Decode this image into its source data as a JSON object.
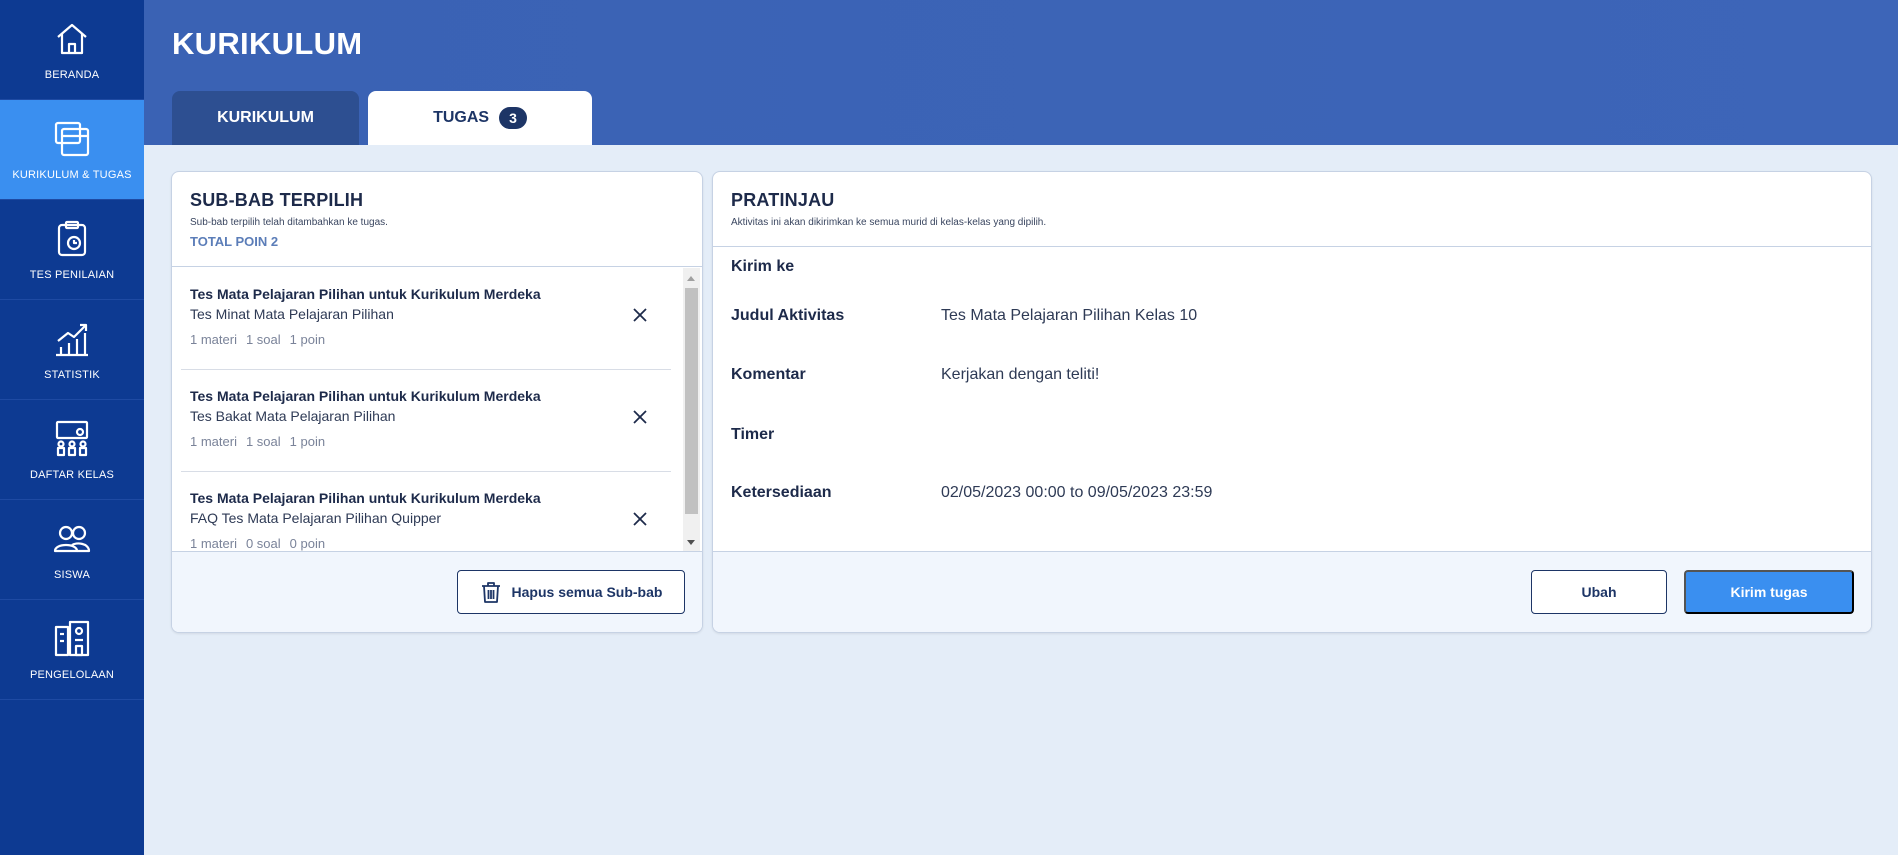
{
  "sidebar": {
    "items": [
      {
        "label": "BERANDA",
        "icon": "home-icon"
      },
      {
        "label": "KURIKULUM & TUGAS",
        "icon": "curriculum-icon",
        "active": true
      },
      {
        "label": "TES PENILAIAN",
        "icon": "assessment-icon"
      },
      {
        "label": "STATISTIK",
        "icon": "chart-icon"
      },
      {
        "label": "DAFTAR KELAS",
        "icon": "classroom-icon"
      },
      {
        "label": "SISWA",
        "icon": "students-icon"
      },
      {
        "label": "PENGELOLAAN",
        "icon": "building-icon"
      }
    ]
  },
  "header": {
    "title": "KURIKULUM",
    "tabs": [
      {
        "label": "KURIKULUM",
        "active": false
      },
      {
        "label": "TUGAS",
        "badge": "3",
        "active": true
      }
    ]
  },
  "left_panel": {
    "title": "SUB-BAB TERPILIH",
    "subtitle": "Sub-bab terpilih telah ditambahkan ke tugas.",
    "total": "TOTAL POIN 2",
    "items": [
      {
        "title": "Tes Mata Pelajaran Pilihan untuk Kurikulum Merdeka",
        "subtitle": "Tes Minat Mata Pelajaran Pilihan",
        "materi": "1 materi",
        "soal": "1 soal",
        "poin": "1 poin"
      },
      {
        "title": "Tes Mata Pelajaran Pilihan untuk Kurikulum Merdeka",
        "subtitle": "Tes Bakat Mata Pelajaran Pilihan",
        "materi": "1 materi",
        "soal": "1 soal",
        "poin": "1 poin"
      },
      {
        "title": "Tes Mata Pelajaran Pilihan untuk Kurikulum Merdeka",
        "subtitle": "FAQ Tes Mata Pelajaran Pilihan Quipper",
        "materi": "1 materi",
        "soal": "0 soal",
        "poin": "0 poin"
      }
    ],
    "delete_all_label": "Hapus semua Sub-bab"
  },
  "right_panel": {
    "title": "PRATINJAU",
    "subtitle": "Aktivitas ini akan dikirimkan ke semua murid di kelas-kelas yang dipilih.",
    "fields": {
      "kirim_ke": {
        "label": "Kirim ke",
        "value": ""
      },
      "judul": {
        "label": "Judul Aktivitas",
        "value": "Tes Mata Pelajaran Pilihan Kelas 10"
      },
      "komentar": {
        "label": "Komentar",
        "value": "Kerjakan dengan teliti!"
      },
      "timer": {
        "label": "Timer",
        "value": ""
      },
      "ketersediaan": {
        "label": "Ketersediaan",
        "value": "02/05/2023 00:00 to 09/05/2023 23:59"
      }
    },
    "edit_label": "Ubah",
    "send_label": "Kirim tugas"
  },
  "colors": {
    "sidebar_bg": "#0d3a92",
    "sidebar_active": "#3a8ff0",
    "header_bg": "#3d65b8",
    "primary_button": "#3a8ff0",
    "page_bg": "#e4edf8"
  }
}
